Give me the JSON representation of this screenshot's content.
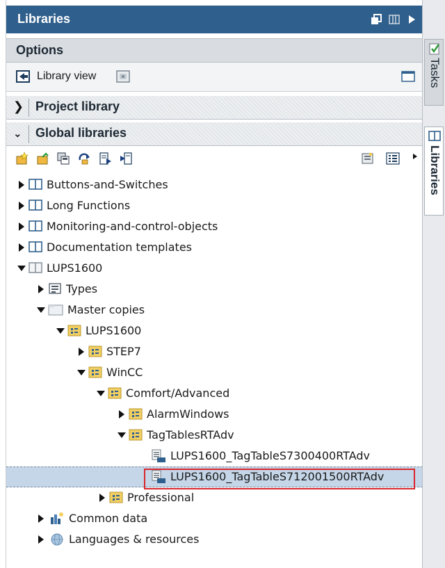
{
  "window": {
    "title": "Libraries",
    "controls": [
      "restore-icon",
      "columns-icon",
      "collapse-arrow-icon"
    ]
  },
  "options": {
    "label": "Options"
  },
  "library_view": {
    "label": "Library view"
  },
  "sections": {
    "project_library": "Project library",
    "global_libraries": "Global libraries"
  },
  "toolbar": {
    "buttons": [
      "new-library-icon",
      "open-library-icon",
      "save-library-icon",
      "update-library-icon",
      "export-icon",
      "import-icon",
      "properties-icon",
      "details-view-icon"
    ]
  },
  "tree": {
    "items": [
      {
        "label": "Buttons-and-Switches",
        "icon": "library-book-icon",
        "state": "collapsed"
      },
      {
        "label": "Long Functions",
        "icon": "library-book-icon",
        "state": "collapsed"
      },
      {
        "label": "Monitoring-and-control-objects",
        "icon": "library-book-icon",
        "state": "collapsed"
      },
      {
        "label": "Documentation templates",
        "icon": "library-book-icon",
        "state": "collapsed"
      },
      {
        "label": "LUPS1600",
        "icon": "library-book-icon",
        "state": "expanded"
      },
      {
        "label": "Types",
        "icon": "types-folder-icon",
        "state": "collapsed"
      },
      {
        "label": "Master copies",
        "icon": "folder-icon",
        "state": "expanded"
      },
      {
        "label": "LUPS1600",
        "icon": "master-folder-icon",
        "state": "expanded"
      },
      {
        "label": "STEP7",
        "icon": "master-folder-icon",
        "state": "collapsed"
      },
      {
        "label": "WinCC",
        "icon": "master-folder-icon",
        "state": "expanded"
      },
      {
        "label": "Comfort/Advanced",
        "icon": "master-folder-icon",
        "state": "expanded"
      },
      {
        "label": "AlarmWindows",
        "icon": "master-folder-icon",
        "state": "collapsed"
      },
      {
        "label": "TagTablesRTAdv",
        "icon": "master-folder-icon",
        "state": "expanded"
      },
      {
        "label": "LUPS1600_TagTableS7300400RTAdv",
        "icon": "tag-table-icon",
        "state": "leaf"
      },
      {
        "label": "LUPS1600_TagTableS712001500RTAdv",
        "icon": "tag-table-icon",
        "state": "leaf"
      },
      {
        "label": "Professional",
        "icon": "master-folder-icon",
        "state": "collapsed"
      },
      {
        "label": "Common data",
        "icon": "common-data-icon",
        "state": "collapsed"
      },
      {
        "label": "Languages & resources",
        "icon": "globe-icon",
        "state": "collapsed"
      }
    ],
    "selected_index": 14
  },
  "sidebar": {
    "tabs": [
      {
        "label": "Tasks",
        "icon": "tasks-icon"
      },
      {
        "label": "Libraries",
        "icon": "libraries-icon"
      }
    ]
  },
  "colors": {
    "titlebar": "#2f5f8c",
    "selection": "#c5d6e8",
    "highlight_border": "#d9262c",
    "folder": "#e8c25a"
  }
}
